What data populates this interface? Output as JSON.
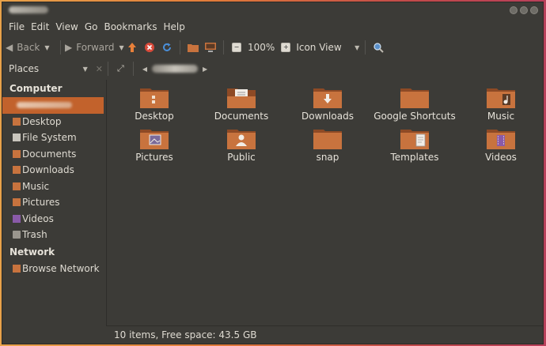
{
  "menu": [
    "File",
    "Edit",
    "View",
    "Go",
    "Bookmarks",
    "Help"
  ],
  "toolbar": {
    "back": "Back",
    "forward": "Forward",
    "zoom": "100%",
    "view_mode": "Icon View"
  },
  "places": {
    "label": "Places"
  },
  "sidebar": {
    "computer_header": "Computer",
    "computer_items": [
      "Desktop",
      "File System",
      "Documents",
      "Downloads",
      "Music",
      "Pictures",
      "Videos",
      "Trash"
    ],
    "network_header": "Network",
    "network_items": [
      "Browse Network"
    ]
  },
  "folders": [
    "Desktop",
    "Documents",
    "Downloads",
    "Google Shortcuts",
    "Music",
    "Pictures",
    "Public",
    "snap",
    "Templates",
    "Videos"
  ],
  "status": "10 items, Free space: 43.5 GB",
  "colors": {
    "accent": "#c2622c",
    "folder": "#c8733e",
    "folder_dark": "#8e4a25",
    "background": "#3c3b37"
  }
}
